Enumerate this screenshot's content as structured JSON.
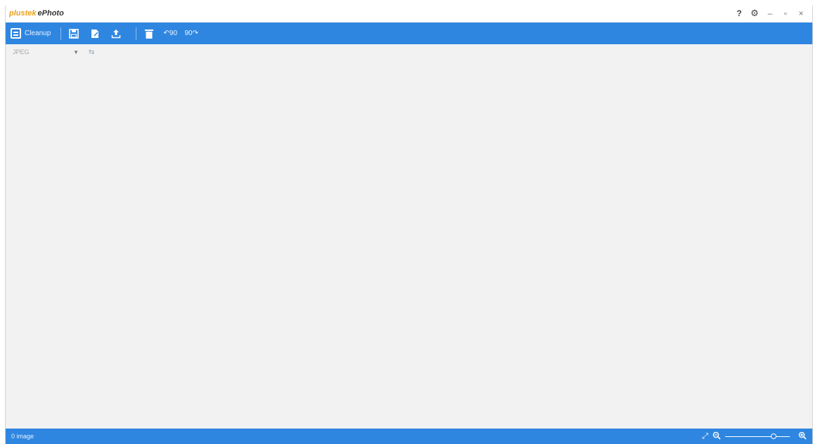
{
  "app": {
    "brand_prefix": "plustek",
    "brand_name": "ePhoto"
  },
  "window_controls": {
    "help": "?",
    "settings": "⚙",
    "minimize": "–",
    "restore": "▫",
    "close": "×"
  },
  "toolbar": {
    "cleanup_label": "Cleanup",
    "icons": [
      "save-icon",
      "edit-icon",
      "upload-icon",
      "delete-icon",
      "rotate-left-90-icon",
      "rotate-right-90-icon"
    ],
    "rotate_left_label": "↶90",
    "rotate_right_label": "90↷",
    "accent": "#2f86e0"
  },
  "format": {
    "selected": "JPEG"
  },
  "status": {
    "image_count": "0 image"
  },
  "zoom": {
    "level": 0.75
  }
}
